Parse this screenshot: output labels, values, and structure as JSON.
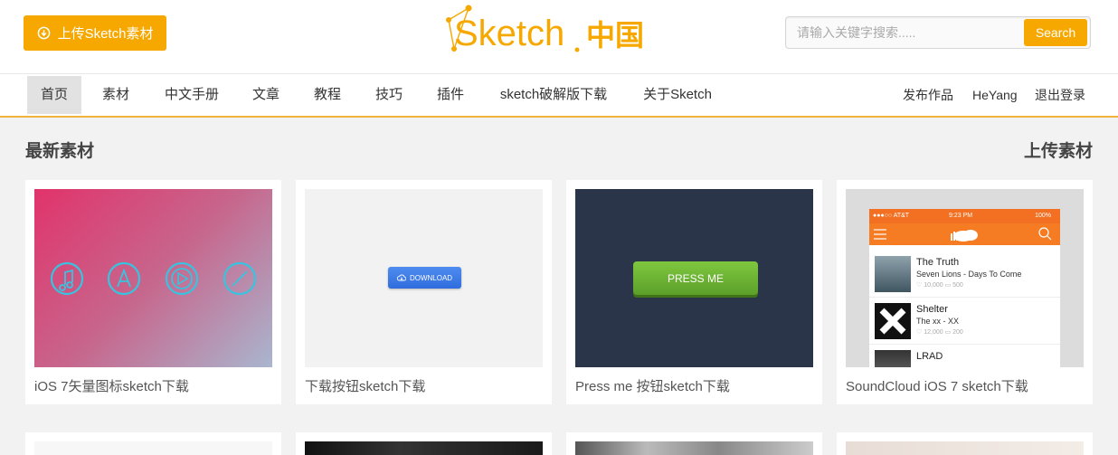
{
  "header": {
    "upload_label": "上传Sketch素材",
    "logo_text": "Sketch",
    "logo_cn": "中国",
    "search_placeholder": "请输入关键字搜索.....",
    "search_button": "Search",
    "accent": "#f7a800"
  },
  "nav": {
    "items": [
      {
        "label": "首页",
        "active": true
      },
      {
        "label": "素材"
      },
      {
        "label": "中文手册"
      },
      {
        "label": "文章"
      },
      {
        "label": "教程"
      },
      {
        "label": "技巧"
      },
      {
        "label": "插件"
      },
      {
        "label": "sketch破解版下载"
      },
      {
        "label": "关于Sketch"
      }
    ],
    "right": [
      "发布作品",
      "HeYang",
      "退出登录"
    ]
  },
  "section": {
    "title": "最新素材",
    "upload_link": "上传素材"
  },
  "cards": [
    {
      "caption": "iOS 7矢量图标sketch下载",
      "thumb": "ios7-icons"
    },
    {
      "caption": "下载按钮sketch下载",
      "thumb": "download-button",
      "button_text": "DOWNLOAD"
    },
    {
      "caption": "Press me 按钮sketch下载",
      "thumb": "press-me-button",
      "button_text": "PRESS ME"
    },
    {
      "caption": "SoundCloud iOS 7 sketch下载",
      "thumb": "soundcloud-ui"
    }
  ],
  "soundcloud": {
    "carrier": "●●●○○ AT&T",
    "time": "9:23 PM",
    "battery": "100%",
    "tracks": [
      {
        "title": "The Truth",
        "sub": "Seven Lions - Days To Come",
        "meta": "♡ 10,000  ▭ 500"
      },
      {
        "title": "Shelter",
        "sub": "The xx - XX",
        "meta": "♡ 12,000  ▭ 200"
      },
      {
        "title": "LRAD",
        "sub": "",
        "meta": ""
      }
    ]
  }
}
